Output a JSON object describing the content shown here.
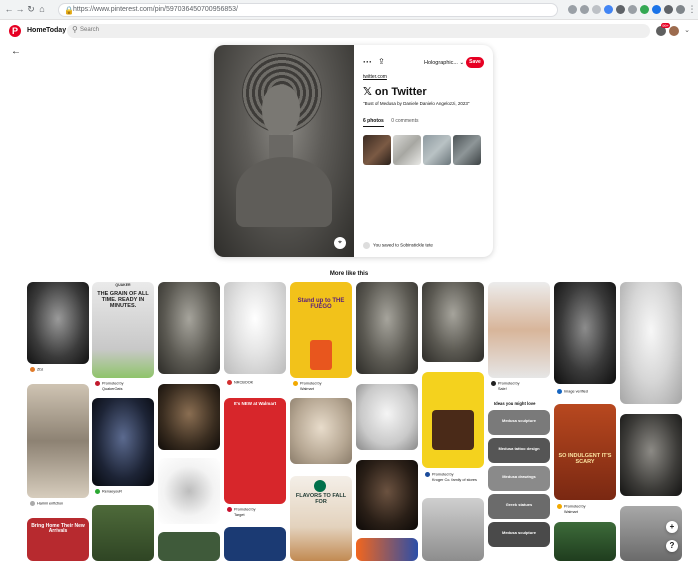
{
  "browser": {
    "url": "https://www.pinterest.com/pin/597036450700956853/"
  },
  "header": {
    "nav_home": "Home",
    "nav_today": "Today",
    "search_placeholder": "Search",
    "notification_count": "99+"
  },
  "pin": {
    "board_selector": "Holographic...",
    "save_label": "Save",
    "source_link": "twitter.com",
    "title": "on Twitter",
    "description": "\"Bust of Medusa by Daniele Danielo Angelozzi, 2023\"",
    "tabs": [
      "6 photos",
      "0 comments"
    ],
    "viewer_text": "You saved to Sobinstickle tete"
  },
  "more_like_this": "More like this",
  "grid": {
    "captions": {
      "c1_user": "Zbz",
      "c2_promoted": "Promoted by",
      "c2_name": "QuakerOats",
      "c4_name": "NRCBOOK",
      "c5_promoted": "Promoted by",
      "c5_name": "Walmart",
      "c8_promoted": "Promoted by",
      "c8_name": "Sale!",
      "c9_name": "Image verified",
      "c1b_name": "Harimi enfiction",
      "c2b_name": "RenaeyouR",
      "c5b_promoted": "Promoted by",
      "c5b_name": "Target",
      "c8b_promoted": "Promoted by",
      "c8b_name": "Kroger Co. family of stores",
      "c9b_promoted": "Promoted by",
      "c9b_name": "Walmart"
    },
    "ideas_heading": "Ideas you might love",
    "ideas": [
      "Medusa sculpture",
      "Medusa tattoo design",
      "Medusa drawings",
      "Greek statues",
      "Medusa sculpture"
    ],
    "quaker_text": "THE GRAIN OF ALL TIME. READY IN MINUTES.",
    "quaker_brand": "QUAKER",
    "fuego_text": "Stand up to THE FUEGO",
    "new_text": "It's NEW at Walmart",
    "sbux_text": "FLAVORS TO FALL FOR",
    "indulgent_text": "SO INDULGENT IT'S SCARY",
    "bring_text": "Bring Home Their New Arrivals"
  }
}
